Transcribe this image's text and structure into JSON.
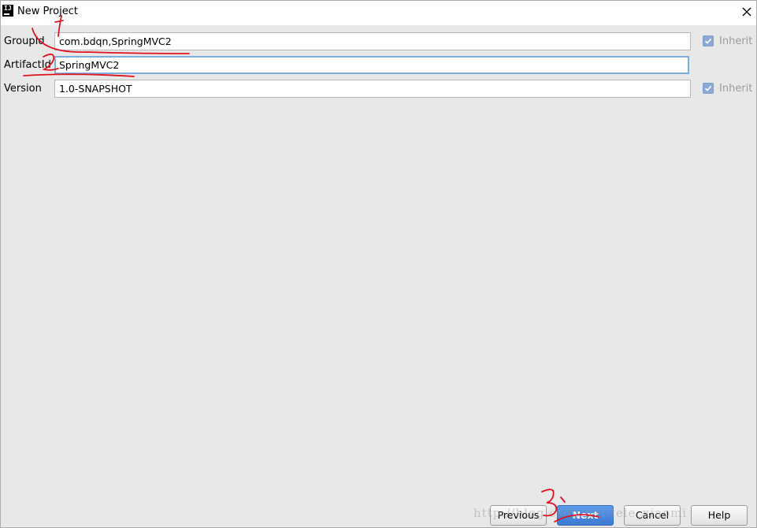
{
  "window": {
    "title": "New Project",
    "icon": "intellij-icon",
    "icon_text": "IJ"
  },
  "form": {
    "group_id": {
      "label": "GroupId",
      "value": "com.bdqn,SpringMVC2",
      "inherit_label": "Inherit",
      "inherit_checked": true
    },
    "artifact_id": {
      "label": "ArtifactId",
      "value": "SpringMVC2"
    },
    "version": {
      "label": "Version",
      "value": "1.0-SNAPSHOT",
      "inherit_label": "Inherit",
      "inherit_checked": true
    }
  },
  "buttons": {
    "previous": "Previous",
    "next": "Next",
    "cancel": "Cancel",
    "help": "Help"
  },
  "annotations": {
    "mark_1": "1",
    "mark_2": "2",
    "mark_3": "3"
  },
  "watermark": "http://blog.csdn.net/lele_xiaomi",
  "colors": {
    "background": "#e8e8e8",
    "accent": "#3b79d3",
    "focus_border": "#7eaddf",
    "annotation_red": "#e0141e"
  }
}
